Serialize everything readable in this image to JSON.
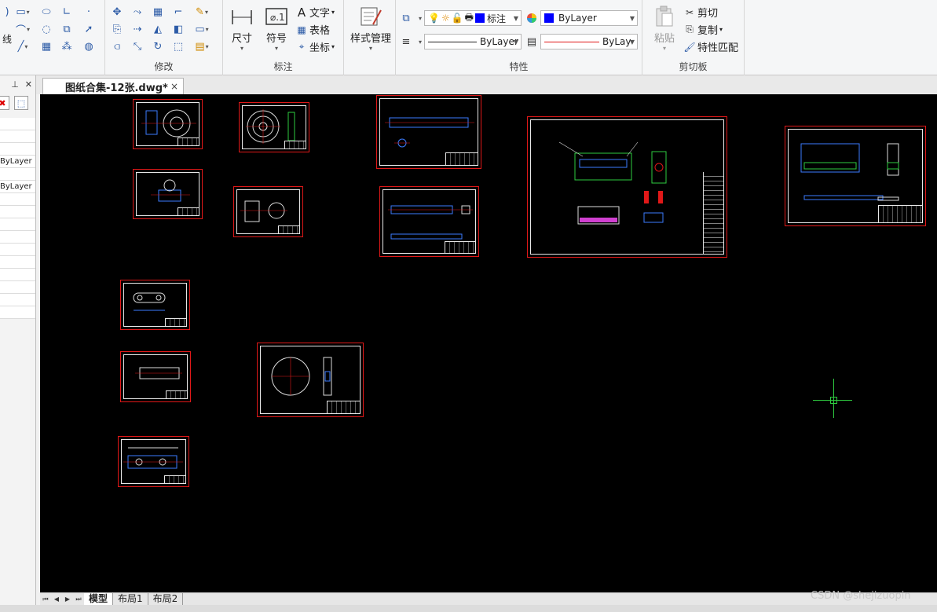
{
  "ribbon": {
    "modify_label": "修改",
    "annotate_label": "标注",
    "properties_label": "特性",
    "clipboard_label": "剪切板",
    "dimension_label": "尺寸",
    "symbol_label": "符号",
    "text_label": "文字",
    "table_label": "表格",
    "coord_label": "坐标",
    "style_manager_label": "样式管理",
    "layer_name": "标注",
    "color_value": "ByLayer",
    "linetype_value": "ByLayer",
    "lineweight_value": "ByLay",
    "paste_label": "粘贴",
    "cut_label": "剪切",
    "copy_label": "复制",
    "match_props_label": "特性匹配",
    "left_cut_text": "线",
    "color_swatch": "#0000ff",
    "lineweight_color": "#e01818"
  },
  "left_panel": {
    "pin_icon": "pin-icon",
    "close_icon": "close-icon",
    "row_a": "ByLayer",
    "row_b": "ByLayer"
  },
  "document": {
    "tab_title": "图纸合集-12张.dwg*",
    "close": "×"
  },
  "layout_tabs": {
    "model": "模型",
    "layout1": "布局1",
    "layout2": "布局2"
  },
  "watermark": "CSDN @shejizuopin",
  "colors": {
    "canvas": "#000000",
    "sheet_border": "#e01818",
    "crosshair": "#2ecc40"
  }
}
